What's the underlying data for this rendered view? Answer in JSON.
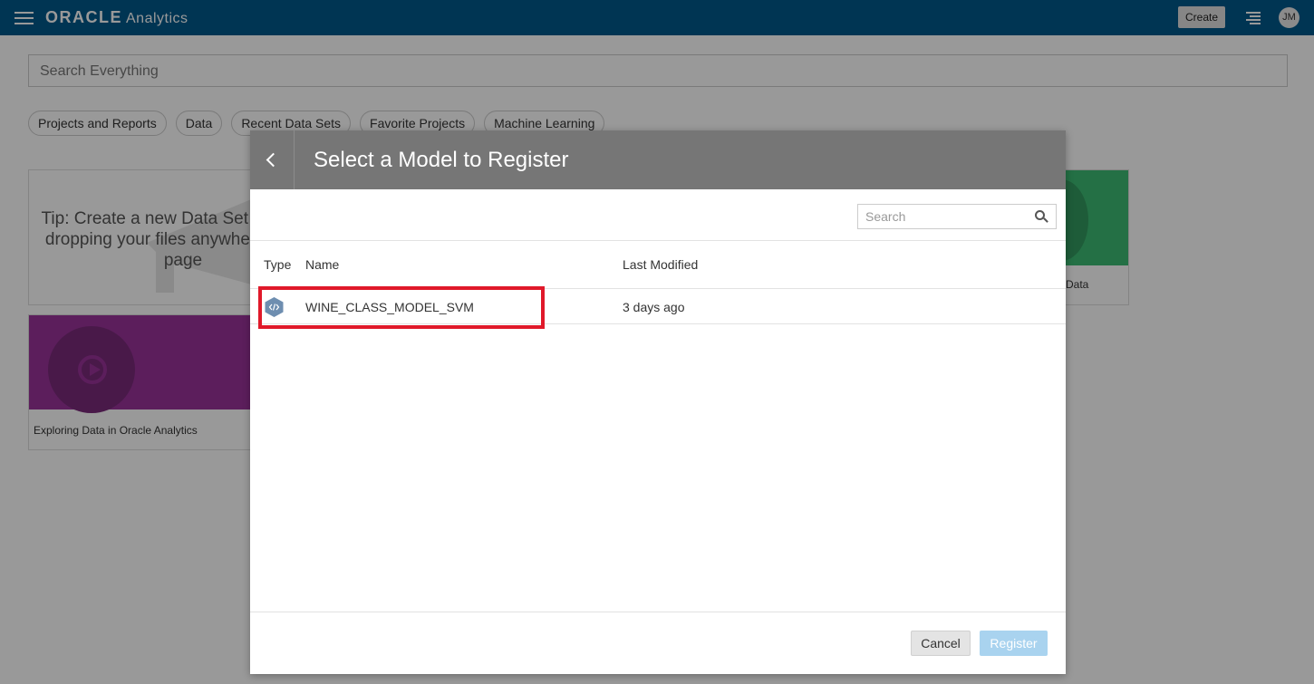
{
  "header": {
    "brand_oracle": "ORACLE",
    "brand_product": "Analytics",
    "create_label": "Create",
    "avatar_initials": "JM",
    "color": "#00598a"
  },
  "search": {
    "placeholder": "Search Everything"
  },
  "chips": [
    "Projects and Reports",
    "Data",
    "Recent Data Sets",
    "Favorite Projects",
    "Machine Learning"
  ],
  "cards": {
    "tip_text": "Tip: Create a new Data Set by simply dropping your files anywhere on this page",
    "video_title": "Exploring Data in Oracle Analytics",
    "green_label": "Data"
  },
  "dialog": {
    "title": "Select a Model to Register",
    "search_placeholder": "Search",
    "columns": {
      "type": "Type",
      "name": "Name",
      "modified": "Last Modified"
    },
    "rows": [
      {
        "type_icon": "model-hex-icon",
        "name": "WINE_CLASS_MODEL_SVM",
        "last_modified": "3 days ago"
      }
    ],
    "cancel_label": "Cancel",
    "register_label": "Register",
    "highlight_color": "#e0192a"
  }
}
